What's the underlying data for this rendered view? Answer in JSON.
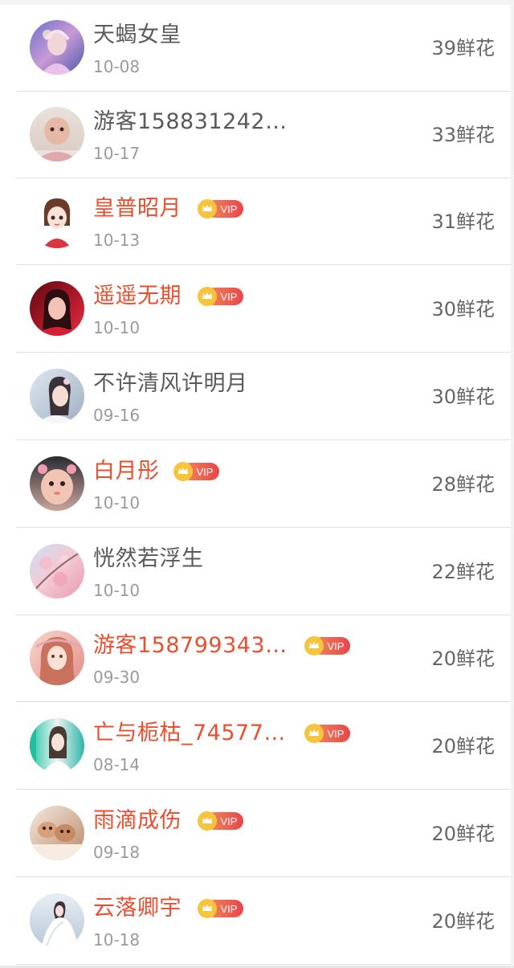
{
  "ranking": {
    "items": [
      {
        "name": "天蝎女皇",
        "date": "10-08",
        "flowers": "39鲜花",
        "vip": false,
        "avatar": "avatar-fantasy-woman"
      },
      {
        "name": "游客158831242…",
        "date": "10-17",
        "flowers": "33鲜花",
        "vip": false,
        "avatar": "avatar-baby"
      },
      {
        "name": "皇普昭月",
        "date": "10-13",
        "flowers": "31鲜花",
        "vip": true,
        "vip_label": "VIP",
        "avatar": "avatar-cartoon-girl"
      },
      {
        "name": "遥遥无期",
        "date": "10-10",
        "flowers": "30鲜花",
        "vip": true,
        "vip_label": "VIP",
        "avatar": "avatar-woman-red"
      },
      {
        "name": "不许清风许明月",
        "date": "09-16",
        "flowers": "30鲜花",
        "vip": false,
        "avatar": "avatar-costume-woman"
      },
      {
        "name": "白月彤",
        "date": "10-10",
        "flowers": "28鲜花",
        "vip": true,
        "vip_label": "VIP",
        "avatar": "avatar-toddler"
      },
      {
        "name": "恍然若浮生",
        "date": "10-10",
        "flowers": "22鲜花",
        "vip": false,
        "avatar": "avatar-blossoms"
      },
      {
        "name": "游客158799343…",
        "date": "09-30",
        "flowers": "20鲜花",
        "vip": true,
        "vip_label": "VIP",
        "avatar": "avatar-illustrated-woman"
      },
      {
        "name": "亡与栀枯_74577…",
        "date": "08-14",
        "flowers": "20鲜花",
        "vip": true,
        "vip_label": "VIP",
        "avatar": "avatar-girl-in-white"
      },
      {
        "name": "雨滴成伤",
        "date": "09-18",
        "flowers": "20鲜花",
        "vip": true,
        "vip_label": "VIP",
        "avatar": "avatar-kittens"
      },
      {
        "name": "云落卿宇",
        "date": "10-18",
        "flowers": "20鲜花",
        "vip": true,
        "vip_label": "VIP",
        "avatar": "avatar-white-dress"
      }
    ]
  },
  "colors": {
    "vip_name": "#e94e2f",
    "normal_name": "#5a5a5a",
    "vip_badge": "#ea5a4e",
    "crown": "#f6c53d"
  }
}
